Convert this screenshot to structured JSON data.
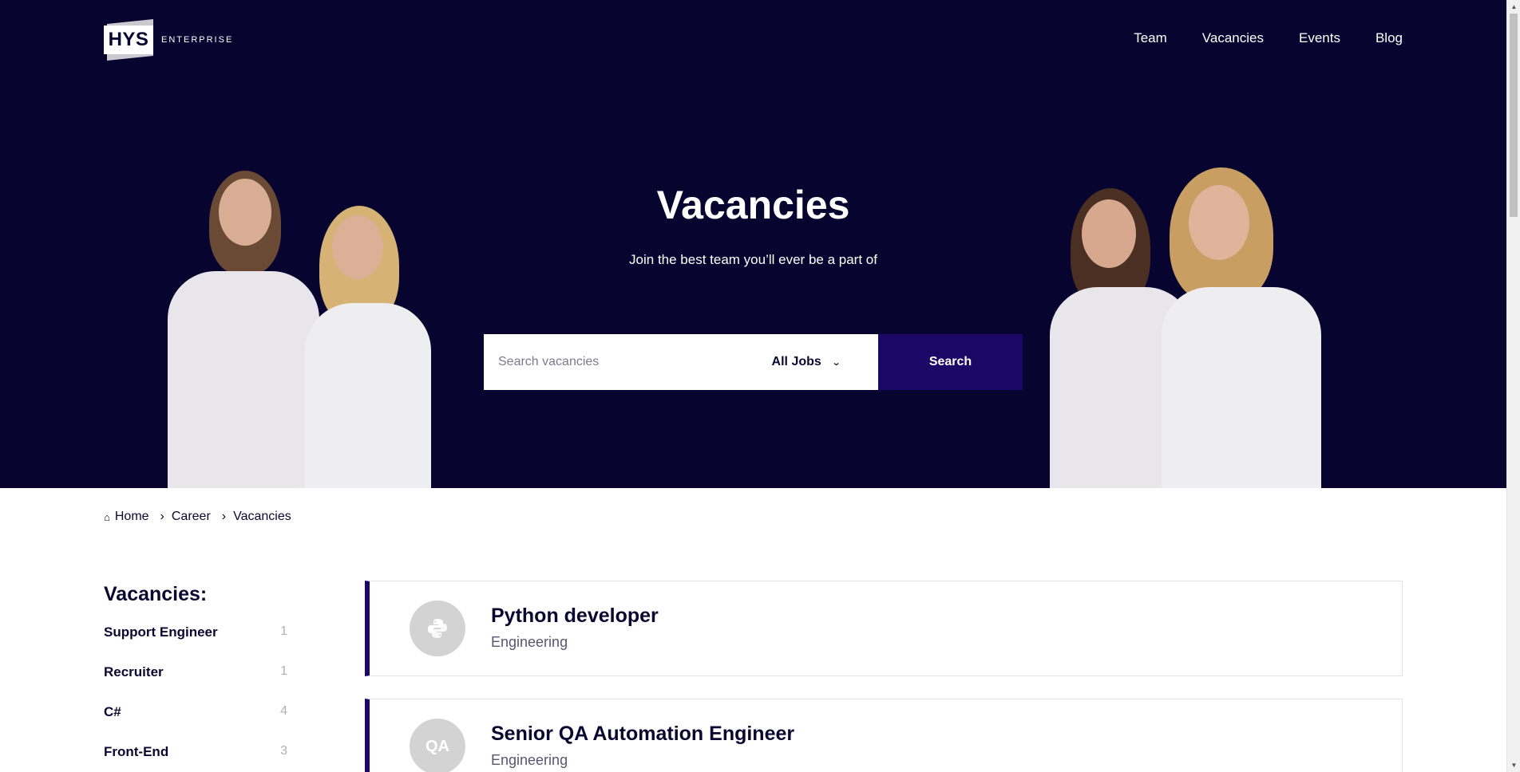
{
  "header": {
    "logo_text": "HYS",
    "logo_subtext": "ENTERPRISE",
    "nav": [
      {
        "label": "Team"
      },
      {
        "label": "Vacancies"
      },
      {
        "label": "Events"
      },
      {
        "label": "Blog"
      }
    ]
  },
  "hero": {
    "title": "Vacancies",
    "subtitle": "Join the best team you’ll ever be a part of",
    "search_placeholder": "Search vacancies",
    "jobs_select_value": "All Jobs",
    "search_button": "Search"
  },
  "breadcrumb": {
    "items": [
      "Home",
      "Career",
      "Vacancies"
    ]
  },
  "sidebar": {
    "title": "Vacancies:",
    "items": [
      {
        "label": "Support Engineer",
        "count": "1"
      },
      {
        "label": "Recruiter",
        "count": "1"
      },
      {
        "label": "C#",
        "count": "4"
      },
      {
        "label": "Front-End",
        "count": "3"
      }
    ]
  },
  "vacancies": [
    {
      "title": "Python developer",
      "department": "Engineering",
      "icon": "python-icon",
      "icon_text": ""
    },
    {
      "title": "Senior QA Automation Engineer",
      "department": "Engineering",
      "icon": "qa-icon",
      "icon_text": "QA"
    }
  ],
  "colors": {
    "hero_bg": "#070430",
    "accent": "#1a0766",
    "text_dark": "#0b0730"
  }
}
